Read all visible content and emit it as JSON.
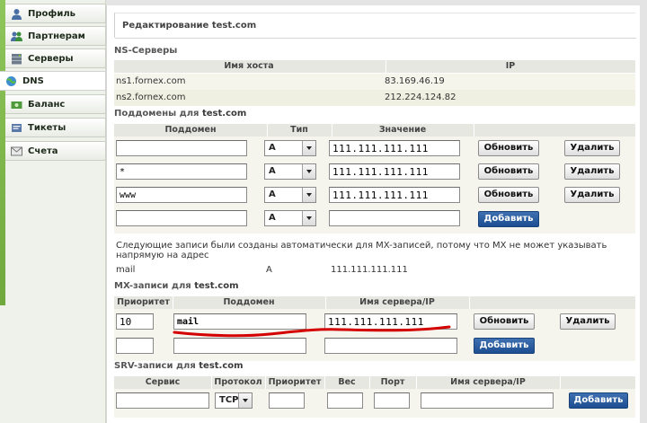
{
  "sidebar": {
    "items": [
      {
        "label": "Профиль",
        "icon": "profile-icon"
      },
      {
        "label": "Партнерам",
        "icon": "partners-icon"
      },
      {
        "label": "Серверы",
        "icon": "servers-icon"
      },
      {
        "label": "DNS",
        "icon": "dns-icon",
        "active": true
      },
      {
        "label": "Баланс",
        "icon": "balance-icon"
      },
      {
        "label": "Тикеты",
        "icon": "tickets-icon"
      },
      {
        "label": "Счета",
        "icon": "invoices-icon"
      }
    ]
  },
  "page": {
    "title_prefix": "Редактирование ",
    "domain": "test.com"
  },
  "ns": {
    "title": "NS-Серверы",
    "headers": [
      "Имя хоста",
      "IP"
    ],
    "rows": [
      {
        "host": "ns1.fornex.com",
        "ip": "83.169.46.19"
      },
      {
        "host": "ns2.fornex.com",
        "ip": "212.224.124.82"
      }
    ]
  },
  "subdomains": {
    "title_prefix": "Поддомены для ",
    "domain": "test.com",
    "headers": [
      "Поддомен",
      "Тип",
      "Значение"
    ],
    "rows": [
      {
        "name": "",
        "type": "A",
        "value": "111.111.111.111"
      },
      {
        "name": "*",
        "type": "A",
        "value": "111.111.111.111"
      },
      {
        "name": "www",
        "type": "A",
        "value": "111.111.111.111"
      }
    ],
    "new_row": {
      "name": "",
      "type": "A",
      "value": ""
    },
    "update_label": "Обновить",
    "delete_label": "Удалить",
    "add_label": "Добавить",
    "auto_note": "Следующие записи были созданы автоматически для MX-записей, потому что MX не может указывать напрямую на адрес",
    "auto_record": {
      "name": "mail",
      "type": "A",
      "value": "111.111.111.111"
    }
  },
  "mx": {
    "title_prefix": "MX-записи для ",
    "domain": "test.com",
    "headers": [
      "Приоритет",
      "Поддомен",
      "Имя сервера/IP"
    ],
    "rows": [
      {
        "priority": "10",
        "subdomain": "mail",
        "server": "111.111.111.111"
      }
    ],
    "update_label": "Обновить",
    "delete_label": "Удалить",
    "add_label": "Добавить"
  },
  "srv": {
    "title_prefix": "SRV-записи для ",
    "domain": "test.com",
    "headers": [
      "Сервис",
      "Протокол",
      "Приоритет",
      "Вес",
      "Порт",
      "Имя сервера/IP"
    ],
    "protocol": "TCP",
    "add_label": "Добавить"
  },
  "colors": {
    "accent_green": "#8fc65b",
    "button_blue": "#1d4e91",
    "annotation_red": "#d40000"
  }
}
